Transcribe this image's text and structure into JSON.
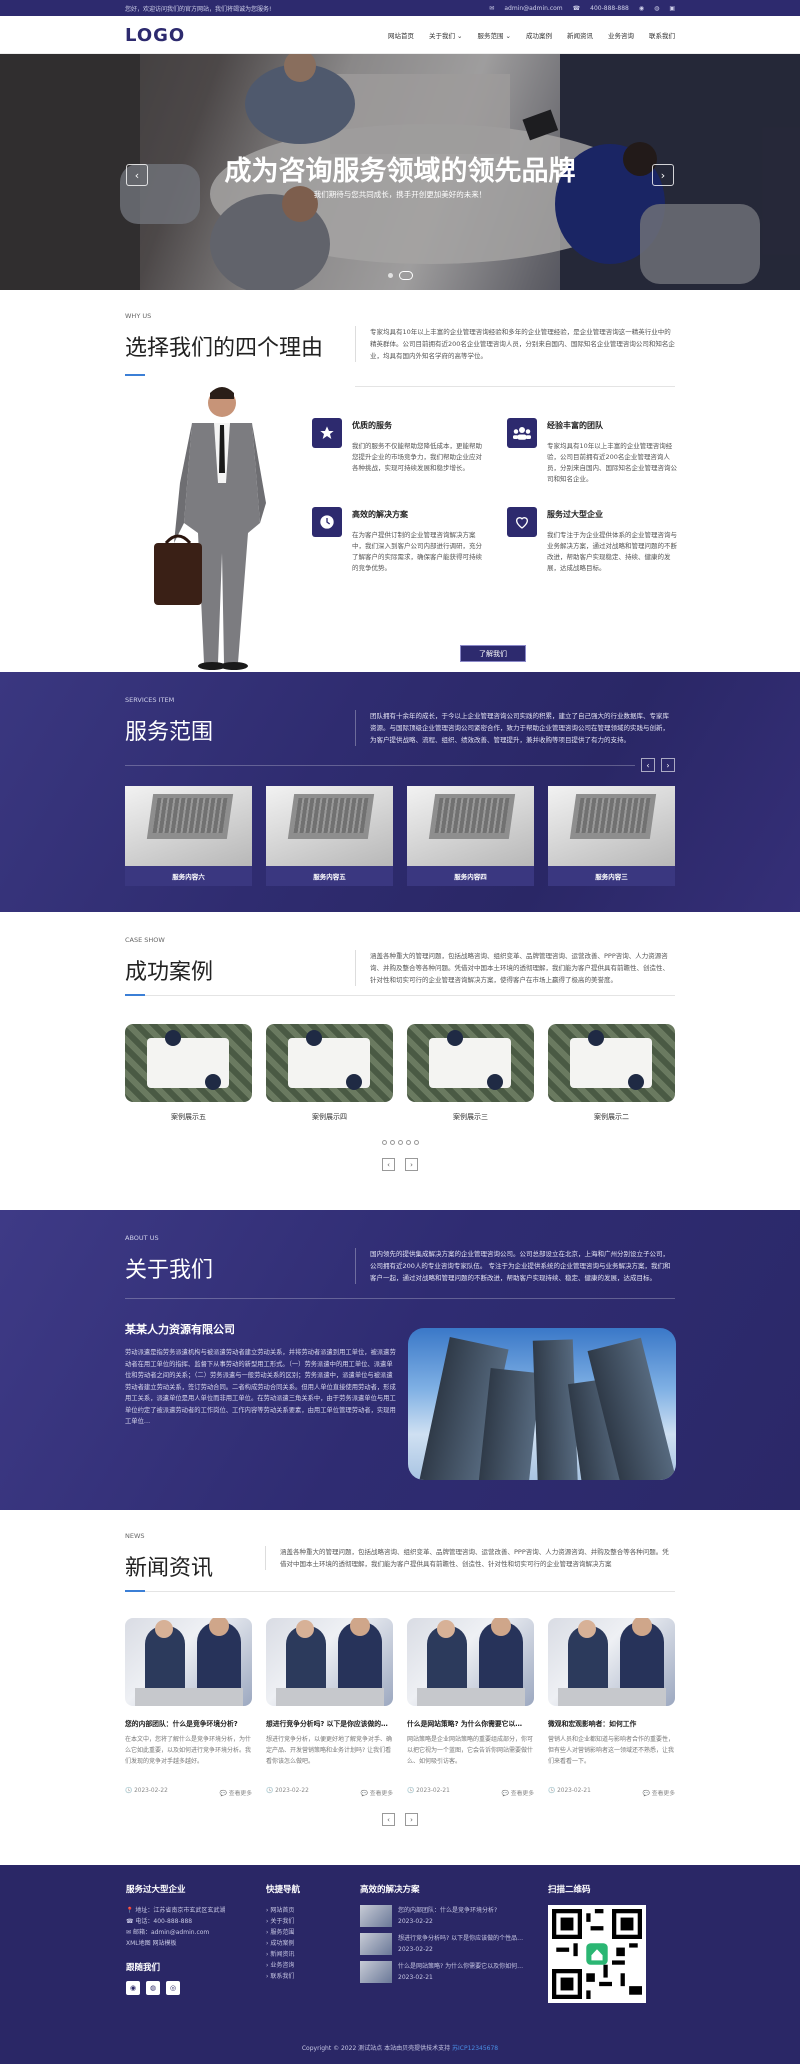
{
  "topbar": {
    "welcome": "您好，欢迎访问我们的官方网站，我们将竭诚为您服务!",
    "email": "admin@admin.com",
    "phone": "400-888-888"
  },
  "header": {
    "logo": "LOGO",
    "nav": [
      "网站首页",
      "关于我们 ⌄",
      "服务范围 ⌄",
      "成功案例",
      "新闻资讯",
      "业务咨询",
      "联系我们"
    ]
  },
  "banner": {
    "title": "成为咨询服务领域的领先品牌",
    "subtitle": "我们期待与您共同成长，携手开创更加美好的未来！",
    "prev": "‹",
    "next": "›"
  },
  "why": {
    "en": "WHY US",
    "cn": "选择我们的四个理由",
    "desc": "专家均具有10年以上丰富的企业管理咨询经验和多年的企业管理经验，是企业管理咨询这一精英行业中的精英群体。公司目前拥有近200名企业管理咨询人员，分别来自国内、国际知名企业管理咨询公司和知名企业，均具有国内外知名学府的高等学位。",
    "features": [
      {
        "icon": "star-icon",
        "title": "优质的服务",
        "desc": "我们的服务不仅能帮助您降低成本，更能帮助您提升企业的市场竞争力，我们帮助企业应对各种挑战，实现可持续发展和稳步增长。"
      },
      {
        "icon": "team-icon",
        "title": "经验丰富的团队",
        "desc": "专家均具有10年以上丰富的企业管理咨询经验，公司目前拥有近200名企业管理咨询人员，分别来自国内、国际知名企业管理咨询公司和知名企业。"
      },
      {
        "icon": "clock-icon",
        "title": "高效的解决方案",
        "desc": "在为客户提供订制的企业管理咨询解决方案中，我们深入到客户公司内部进行调研，充分了解客户的实际需求，确保客户能获得可持续的竞争优势。"
      },
      {
        "icon": "heart-icon",
        "title": "服务过大型企业",
        "desc": "我们专注于为企业提供体系的企业管理咨询与业务解决方案，通过对战略和管理问题的不断改进，帮助客户实现稳定、持续、健康的发展，达成战略目标。"
      }
    ],
    "more": "了解我们"
  },
  "services": {
    "en": "SERVICES ITEM",
    "cn": "服务范围",
    "desc": "团队拥有十余年的成长，于今以上企业管理咨询公司实践的积累，建立了自己强大的行业数据库、专家库资源。与国际顶级企业管理咨询公司紧密合作，致力于帮助企业管理咨询公司在管理领域的实践与创新，为客户提供战略、流程、组织、绩效改善、管理提升，兼并收购等项目提供了有力的支持。",
    "items": [
      "服务内容六",
      "服务内容五",
      "服务内容四",
      "服务内容三"
    ]
  },
  "cases": {
    "en": "CASE SHOW",
    "cn": "成功案例",
    "desc": "涵盖各种重大的管理问题，包括战略咨询、组织变革、品牌管理咨询、运营改善、PPP咨询、人力资源咨询、并购及整合等各种问题。凭借对中国本土环境的透彻理解，我们能为客户提供具有前瞻性、创造性、针对性和切实可行的企业管理咨询解决方案，使得客户在市场上赢得了极高的美誉度。",
    "items": [
      "案例展示五",
      "案例展示四",
      "案例展示三",
      "案例展示二"
    ]
  },
  "about": {
    "en": "ABOUT US",
    "cn": "关于我们",
    "desc": "国内领先的提供集成解决方案的企业管理咨询公司。公司总部设立在北京，上海和广州分别设立子公司，公司拥有近200人的专业咨询专家队伍。 专注于为企业提供系统的企业管理咨询与业务解决方案，我们和客户一起，通过对战略和管理问题的不断改进，帮助客户实现持续、稳定、健康的发展，达成目标。",
    "company": "某某人力资源有限公司",
    "text": "劳动派遣是指劳务派遣机构与被派遣劳动者建立劳动关系，并将劳动者派遣到用工单位，被派遣劳动者在用工单位的指挥、监督下从事劳动的新型用工形式。（一）劳务派遣中的用工单位、派遣单位和劳动者之间的关系；（二）劳务派遣与一般劳动关系的区别；劳务派遣中，派遣单位与被派遣劳动者建立劳动关系，签订劳动合同。二者构成劳动合同关系。但用人单位直接使用劳动者，形成用工关系，派遣单位是用人单位而非用工单位。在劳动派遣三角关系中，由于劳务派遣单位与用工单位约定了被派遣劳动者的工作岗位、工作内容等劳动关系要素，由用工单位管理劳动者，实现用工单位…"
  },
  "news": {
    "en": "NEWS",
    "cn": "新闻资讯",
    "desc": "涵盖各种重大的管理问题，包括战略咨询、组织变革、品牌管理咨询、运营改善、PPP咨询、人力资源咨询、并购及整合等各种问题。凭借对中国本土环境的透彻理解，我们能为客户提供具有前瞻性、创造性、针对性和切实可行的企业管理咨询解决方案",
    "items": [
      {
        "title": "您的内部团队：什么是竞争环境分析?",
        "desc": "在本文中，您将了解什么是竞争环境分析，为什么它如此重要，以及如何进行竞争环境分析。我们发现的竞争对手越多越好。",
        "date": "2023-02-22",
        "more": "查看更多"
      },
      {
        "title": "想进行竞争分析吗? 以下是你应该做的…",
        "desc": "想进行竞争分析，以便更好地了解竞争对手、确定产品、开发营销策略和业务计划吗? 让我们看看你该怎么做吧。",
        "date": "2023-02-22",
        "more": "查看更多"
      },
      {
        "title": "什么是网站策略? 为什么你需要它以…",
        "desc": "网站策略是企业网站策略的重要组成部分，你可以把它视为一个蓝图，它会告诉你网站需要做什么、如何吸引访客。",
        "date": "2023-02-21",
        "more": "查看更多"
      },
      {
        "title": "微观和宏观影响者：如何工作",
        "desc": "营销人员和企业都知道与影响者合作的重要性，但有些人对营销影响者这一领域还不熟悉，让我们来看看一下。",
        "date": "2023-02-21",
        "more": "查看更多"
      }
    ],
    "prev": "‹",
    "next": "›"
  },
  "footer": {
    "col1": {
      "title": "服务过大型企业",
      "address": "地址：江苏省南京市玄武区玄武湖",
      "phone": "电话：400-888-888",
      "email": "邮箱：admin@admin.com",
      "xml": "XML地图 网站模板",
      "follow": "跟随我们"
    },
    "col2": {
      "title": "快捷导航",
      "links": [
        "网站首页",
        "关于我们",
        "服务范围",
        "成功案例",
        "新闻资讯",
        "业务咨询",
        "联系我们"
      ]
    },
    "col3": {
      "title": "高效的解决方案",
      "items": [
        {
          "title": "您的内部团队：什么是竞争环境分析?",
          "date": "2023-02-22"
        },
        {
          "title": "想进行竞争分析吗? 以下是你应该做的个性品…",
          "date": "2023-02-22"
        },
        {
          "title": "什么是网站策略? 为什么你需要它以及你如何…",
          "date": "2023-02-21"
        }
      ]
    },
    "col4": {
      "title": "扫描二维码"
    },
    "copyright": "Copyright © 2022 测试站点 本站由贝壳提供技术支持",
    "icp": "苏ICP12345678"
  },
  "colors": {
    "primary": "#2d2a6e",
    "accent": "#3b7fd6"
  }
}
